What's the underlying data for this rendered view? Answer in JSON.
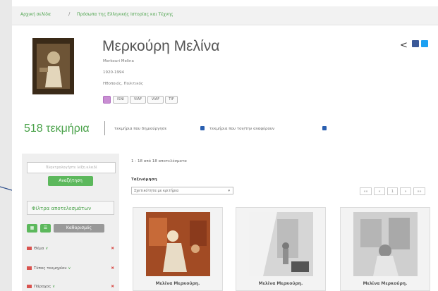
{
  "breadcrumb": {
    "home": "Αρχική σελίδα",
    "current": "Πρόσωπα της Ελληνικής Ιστορίας και Τέχνης"
  },
  "person": {
    "name": "Μερκούρη Μελίνα",
    "latin_name": "Merkouri Melina",
    "years": "1920-1994",
    "roles": "Ηθοποιός, Πολιτικός",
    "chips": [
      "ISNI",
      "VIAF",
      "VIAF",
      "TIF"
    ]
  },
  "share": {
    "share_label": "<",
    "fb_color": "#3b5998",
    "tw_color": "#1da1f2"
  },
  "summary": {
    "count": "518 τεκμήρια",
    "option1": "τεκμήρια που δημιούργησε",
    "option2": "τεκμήρια που τον/την αναφέρουν"
  },
  "sidebar": {
    "search_placeholder": "Πληκτρολογήστε λέξη κλειδί",
    "search_button": "Αναζήτηση",
    "filters_title": "Φίλτρα αποτελεσμάτων",
    "toggle_a": "▦",
    "toggle_b": "☰",
    "clear": "Καθαρισμός",
    "facets": [
      {
        "label": "Θέμα",
        "chev": "∨",
        "x": "✖"
      },
      {
        "label": "Τύπος τεκμηρίου",
        "chev": "∨",
        "x": "✖"
      },
      {
        "label": "Πάροχος",
        "chev": "∨",
        "x": "✖"
      }
    ]
  },
  "list": {
    "results": "1 - 18 από 18 αποτελέσματα",
    "sort_label": "Ταξινόμηση",
    "sort_value": "Σχετικότητα με κριτήρια",
    "pager": [
      "««",
      "«",
      "1",
      "»",
      "»»"
    ]
  },
  "cards": [
    {
      "caption": "Μελίνα Μερκούρη."
    },
    {
      "caption": "Μελίνα Μερκούρη."
    },
    {
      "caption": "Μελίνα Μερκούρη."
    }
  ],
  "colors": {
    "accent": "#4aa24a",
    "button": "#5cb85c",
    "badge": "#2a5fb0",
    "delete": "#d9534f"
  }
}
